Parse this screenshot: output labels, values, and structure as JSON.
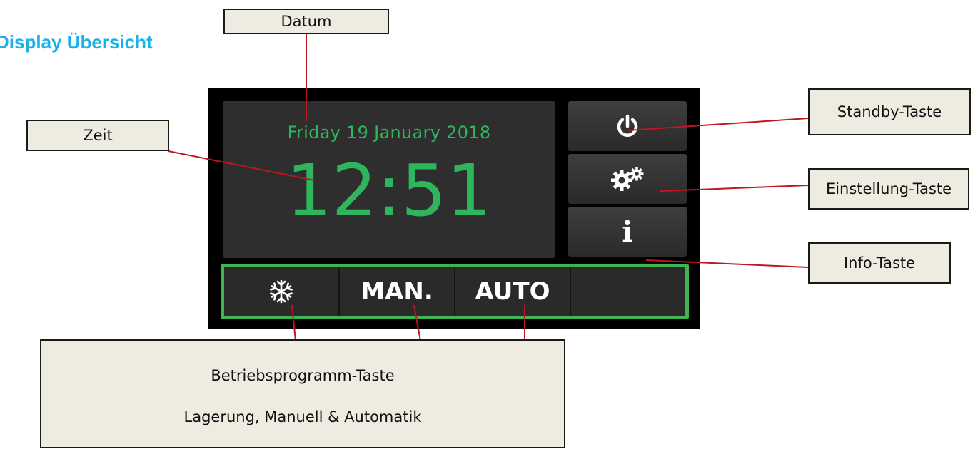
{
  "heading": "Display Übersicht",
  "callouts": {
    "datum": "Datum",
    "zeit": "Zeit",
    "standby": "Standby-Taste",
    "einstellung": "Einstellung-Taste",
    "info": "Info-Taste",
    "program_line1": "Betriebsprogramm-Taste",
    "program_line2": "Lagerung, Manuell & Automatik"
  },
  "display": {
    "date": "Friday 19 January 2018",
    "time": "12:51",
    "info_label": "i",
    "modes": {
      "storage_icon": "snowflake-icon",
      "manual": "MAN.",
      "auto": "AUTO",
      "empty": ""
    }
  },
  "colors": {
    "heading": "#1ab0e8",
    "display_green": "#2fb55b",
    "mode_border": "#3db64f",
    "leader_line": "#c0161e",
    "callout_bg": "#eeece1"
  }
}
